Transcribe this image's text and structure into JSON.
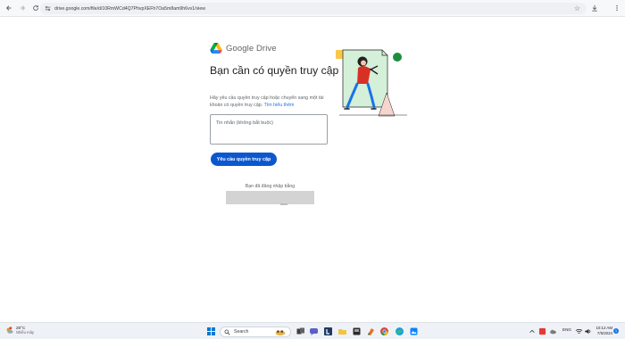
{
  "browser": {
    "url": "drive.google.com/file/d/10RmWCd4Q7PhvpXEFh7Oa5m8am9h6vv1/view"
  },
  "page": {
    "brand": "Google Drive",
    "title": "Bạn cần có quyền truy cập",
    "description": "Hãy yêu cầu quyền truy cập hoặc chuyển sang một tài khoản có quyền truy cập.",
    "learn_more": "Tìm hiểu thêm",
    "message_placeholder": "Tin nhắn (không bắt buộc)",
    "request_button": "Yêu cầu quyền truy cập",
    "signed_in_as": "Bạn đã đăng nhập bằng"
  },
  "taskbar": {
    "weather_temp": "28°C",
    "weather_condition": "Nhiều mây",
    "search_label": "Search",
    "language": "ENG",
    "time": "10:12 AM",
    "date": "7/5/2024",
    "notification_count": "1"
  },
  "colors": {
    "accent": "#0b57d0",
    "link": "#1a73e8"
  }
}
